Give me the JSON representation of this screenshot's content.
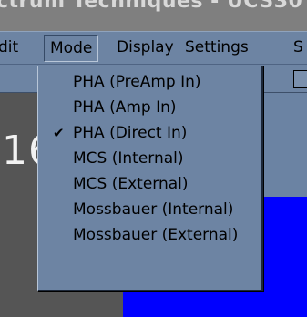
{
  "window": {
    "title": "ctrum Techniques - UCS30 -"
  },
  "menubar": {
    "items": [
      {
        "label": "dit"
      },
      {
        "label": "Mode"
      },
      {
        "label": "Display"
      },
      {
        "label": "Settings"
      },
      {
        "label": "S"
      }
    ]
  },
  "display": {
    "readout": "16"
  },
  "mode_menu": {
    "items": [
      {
        "label": "PHA (PreAmp In)",
        "checked": false
      },
      {
        "label": "PHA (Amp In)",
        "checked": false
      },
      {
        "label": "PHA (Direct In)",
        "checked": true
      },
      {
        "label": "MCS (Internal)",
        "checked": false
      },
      {
        "label": "MCS (External)",
        "checked": false
      },
      {
        "label": "Mossbauer (Internal)",
        "checked": false
      },
      {
        "label": "Mossbauer (External)",
        "checked": false
      }
    ],
    "check_glyph": "✔"
  },
  "colors": {
    "chrome": "#6d84a3",
    "title_bg": "#7f7f7f",
    "plot_left": "#555555",
    "plot_blue": "#0000ff"
  }
}
